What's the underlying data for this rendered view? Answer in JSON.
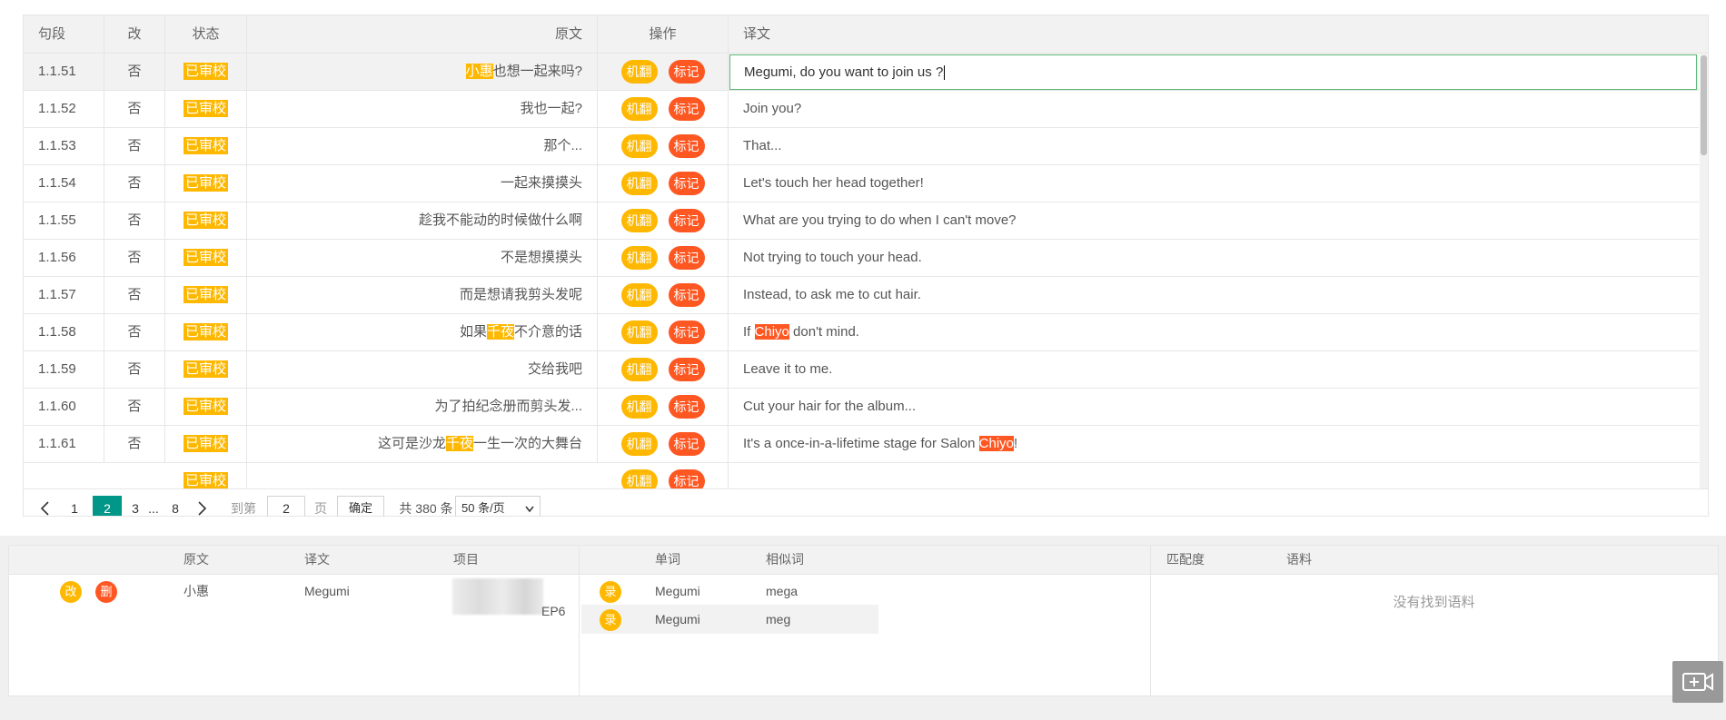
{
  "table": {
    "headers": {
      "segment": "句段",
      "changed": "改",
      "status": "状态",
      "source": "原文",
      "actions": "操作",
      "translation": "译文"
    },
    "action_labels": {
      "machine": "机翻",
      "mark": "标记"
    },
    "editing_value": "Megumi, do you want to join us ?",
    "rows": [
      {
        "seg": "1.1.51",
        "changed": "否",
        "status": "已审校",
        "source": [
          [
            "小惠",
            "y"
          ],
          [
            "也想一起来吗?",
            ""
          ]
        ],
        "trans": [
          [
            "Megumi, do you want to join us ?",
            ""
          ]
        ]
      },
      {
        "seg": "1.1.52",
        "changed": "否",
        "status": "已审校",
        "source": [
          [
            "我也一起?",
            ""
          ]
        ],
        "trans": [
          [
            "Join you?",
            ""
          ]
        ]
      },
      {
        "seg": "1.1.53",
        "changed": "否",
        "status": "已审校",
        "source": [
          [
            "那个...",
            ""
          ]
        ],
        "trans": [
          [
            "That...",
            ""
          ]
        ]
      },
      {
        "seg": "1.1.54",
        "changed": "否",
        "status": "已审校",
        "source": [
          [
            "一起来摸摸头",
            ""
          ]
        ],
        "trans": [
          [
            "Let's touch her head together!",
            ""
          ]
        ]
      },
      {
        "seg": "1.1.55",
        "changed": "否",
        "status": "已审校",
        "source": [
          [
            "趁我不能动的时候做什么啊",
            ""
          ]
        ],
        "trans": [
          [
            "What are you trying to do when I can't move?",
            ""
          ]
        ]
      },
      {
        "seg": "1.1.56",
        "changed": "否",
        "status": "已审校",
        "source": [
          [
            "不是想摸摸头",
            ""
          ]
        ],
        "trans": [
          [
            "Not trying to touch your head.",
            ""
          ]
        ]
      },
      {
        "seg": "1.1.57",
        "changed": "否",
        "status": "已审校",
        "source": [
          [
            "而是想请我剪头发呢",
            ""
          ]
        ],
        "trans": [
          [
            "Instead, to ask me to cut hair.",
            ""
          ]
        ]
      },
      {
        "seg": "1.1.58",
        "changed": "否",
        "status": "已审校",
        "source": [
          [
            "如果",
            ""
          ],
          [
            "千夜",
            "y"
          ],
          [
            "不介意的话",
            ""
          ]
        ],
        "trans": [
          [
            "If ",
            ""
          ],
          [
            "Chiyo",
            "o"
          ],
          [
            " don't mind.",
            ""
          ]
        ]
      },
      {
        "seg": "1.1.59",
        "changed": "否",
        "status": "已审校",
        "source": [
          [
            "交给我吧",
            ""
          ]
        ],
        "trans": [
          [
            "Leave it to me.",
            ""
          ]
        ]
      },
      {
        "seg": "1.1.60",
        "changed": "否",
        "status": "已审校",
        "source": [
          [
            "为了拍纪念册而剪头发...",
            ""
          ]
        ],
        "trans": [
          [
            "Cut your hair for the album...",
            ""
          ]
        ]
      },
      {
        "seg": "1.1.61",
        "changed": "否",
        "status": "已审校",
        "source": [
          [
            "这可是沙龙",
            ""
          ],
          [
            "千夜",
            "y"
          ],
          [
            "一生一次的大舞台",
            ""
          ]
        ],
        "trans": [
          [
            "It's a once-in-a-lifetime stage for Salon ",
            ""
          ],
          [
            "Chiyo",
            "o"
          ],
          [
            "!",
            ""
          ]
        ]
      }
    ]
  },
  "pager": {
    "prev_icon": "chevron-left-icon",
    "next_icon": "chevron-right-icon",
    "pages": [
      "1",
      "2",
      "3",
      "...",
      "8"
    ],
    "current": "2",
    "goto_label": "到第",
    "goto_value": "2",
    "page_unit": "页",
    "confirm": "确定",
    "total": "共 380 条",
    "page_size": "50 条/页"
  },
  "glossary": {
    "headers": {
      "source": "原文",
      "translation": "译文",
      "project": "项目"
    },
    "edit_label": "改",
    "delete_label": "删",
    "entry": {
      "source": "小惠",
      "translation": "Megumi",
      "project_suffix": "EP6"
    }
  },
  "similar": {
    "headers": {
      "word": "单词",
      "similar": "相似词"
    },
    "record_label": "录",
    "rows": [
      {
        "word": "Megumi",
        "similar": "mega"
      },
      {
        "word": "Megumi",
        "similar": "meg"
      }
    ]
  },
  "corpus": {
    "headers": {
      "match": "匹配度",
      "corpus": "语料"
    },
    "empty": "没有找到语料"
  },
  "colors": {
    "accent": "#009688",
    "yellow": "#ffb800",
    "orange": "#ff5722",
    "edit_border": "#5fb878"
  },
  "icons": {
    "screen_record": "camera-icon"
  }
}
